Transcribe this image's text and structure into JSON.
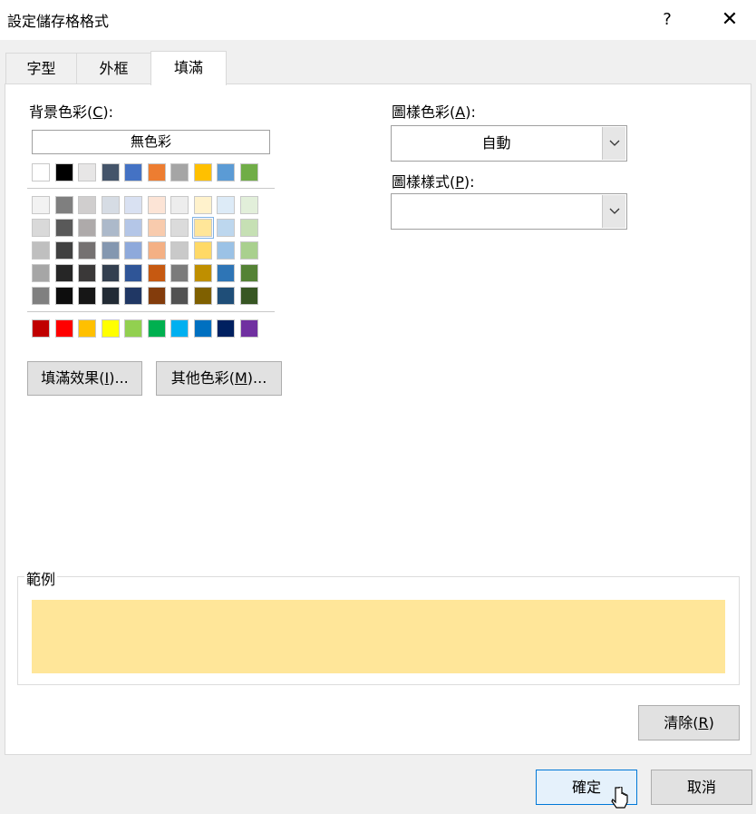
{
  "window": {
    "title": "設定儲存格格式",
    "help_label": "?",
    "close_label": "✕"
  },
  "tabs": [
    {
      "label": "字型",
      "active": false
    },
    {
      "label": "外框",
      "active": false
    },
    {
      "label": "填滿",
      "active": true
    }
  ],
  "background": {
    "label_prefix": "背景色彩(",
    "label_key": "C",
    "label_suffix": "):",
    "no_color_label": "無色彩",
    "theme_row": [
      "#FFFFFF",
      "#000000",
      "#E7E6E6",
      "#44546A",
      "#4472C4",
      "#ED7D31",
      "#A5A5A5",
      "#FFC000",
      "#5B9BD5",
      "#70AD47"
    ],
    "shade_rows": [
      [
        "#F2F2F2",
        "#7F7F7F",
        "#D0CECE",
        "#D6DCE4",
        "#D9E1F2",
        "#FCE4D6",
        "#EDEDED",
        "#FFF2CC",
        "#DDEBF7",
        "#E2EFDA"
      ],
      [
        "#D9D9D9",
        "#595959",
        "#AEAAAA",
        "#ACB9CA",
        "#B4C6E7",
        "#F8CBAD",
        "#DBDBDB",
        "#FFE699",
        "#BDD7EE",
        "#C6E0B4"
      ],
      [
        "#BFBFBF",
        "#404040",
        "#757171",
        "#8497B0",
        "#8EA9DB",
        "#F4B084",
        "#C9C9C9",
        "#FFD966",
        "#9BC2E6",
        "#A9D08E"
      ],
      [
        "#A6A6A6",
        "#262626",
        "#3A3838",
        "#333F4F",
        "#2F5597",
        "#C65911",
        "#7B7B7B",
        "#BF8F00",
        "#2E75B6",
        "#548235"
      ],
      [
        "#808080",
        "#0D0D0D",
        "#161616",
        "#222B35",
        "#203764",
        "#833C0C",
        "#525252",
        "#7F6000",
        "#1F4E78",
        "#375623"
      ]
    ],
    "standard_row": [
      "#C00000",
      "#FF0000",
      "#FFC000",
      "#FFFF00",
      "#92D050",
      "#00B050",
      "#00B0F0",
      "#0070C0",
      "#002060",
      "#7030A0"
    ],
    "selected_swatch": "#FFE699",
    "fill_effects_prefix": "填滿效果(",
    "fill_effects_key": "I",
    "fill_effects_suffix": ")...",
    "more_colors_prefix": "其他色彩(",
    "more_colors_key": "M",
    "more_colors_suffix": ")..."
  },
  "pattern_color": {
    "label_prefix": "圖樣色彩(",
    "label_key": "A",
    "label_suffix": "):",
    "value": "自動"
  },
  "pattern_style": {
    "label_prefix": "圖樣樣式(",
    "label_key": "P",
    "label_suffix": "):",
    "value": ""
  },
  "sample": {
    "legend": "範例",
    "color": "#FFE699"
  },
  "clear_button": {
    "prefix": "清除(",
    "key": "R",
    "suffix": ")"
  },
  "ok_label": "確定",
  "cancel_label": "取消"
}
